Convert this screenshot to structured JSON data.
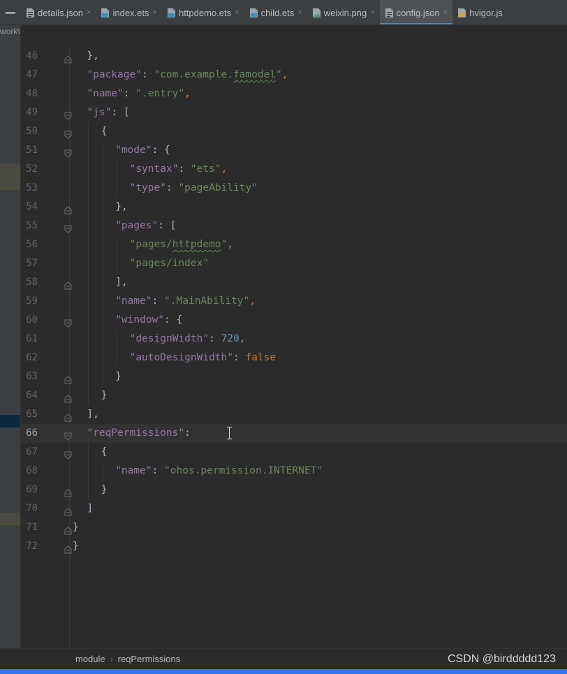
{
  "tabs": [
    {
      "label": "details.json",
      "icon": "json-file-icon",
      "active": false,
      "closable": true
    },
    {
      "label": "index.ets",
      "icon": "ets-file-icon",
      "active": false,
      "closable": true
    },
    {
      "label": "httpdemo.ets",
      "icon": "ets-file-icon",
      "active": false,
      "closable": true
    },
    {
      "label": "child.ets",
      "icon": "ets-file-icon",
      "active": false,
      "closable": true
    },
    {
      "label": "weixin.png",
      "icon": "image-file-icon",
      "active": false,
      "closable": true
    },
    {
      "label": "config.json",
      "icon": "json-file-icon",
      "active": true,
      "closable": true
    },
    {
      "label": "hvigor.js",
      "icon": "js-file-icon",
      "active": false,
      "closable": true
    }
  ],
  "tab_close_glyph": "×",
  "project_path_fragment": "work\\",
  "editor": {
    "current_line": 66,
    "lines": [
      {
        "n": "46",
        "fold": "end"
      },
      {
        "n": "47",
        "fold": ""
      },
      {
        "n": "48",
        "fold": ""
      },
      {
        "n": "49",
        "fold": "start"
      },
      {
        "n": "50",
        "fold": "start"
      },
      {
        "n": "51",
        "fold": "start"
      },
      {
        "n": "52",
        "fold": ""
      },
      {
        "n": "53",
        "fold": ""
      },
      {
        "n": "54",
        "fold": "end"
      },
      {
        "n": "55",
        "fold": "start"
      },
      {
        "n": "56",
        "fold": ""
      },
      {
        "n": "57",
        "fold": ""
      },
      {
        "n": "58",
        "fold": "end"
      },
      {
        "n": "59",
        "fold": ""
      },
      {
        "n": "60",
        "fold": "start"
      },
      {
        "n": "61",
        "fold": ""
      },
      {
        "n": "62",
        "fold": ""
      },
      {
        "n": "63",
        "fold": "end"
      },
      {
        "n": "64",
        "fold": "end"
      },
      {
        "n": "65",
        "fold": "end"
      },
      {
        "n": "66",
        "fold": "start"
      },
      {
        "n": "67",
        "fold": "start"
      },
      {
        "n": "68",
        "fold": ""
      },
      {
        "n": "69",
        "fold": "end"
      },
      {
        "n": "70",
        "fold": "end"
      },
      {
        "n": "71",
        "fold": "end"
      },
      {
        "n": "72",
        "fold": "end"
      }
    ],
    "tokens": {
      "l46": "},",
      "l47_key": "\"package\"",
      "l47_val": "\"com.example.",
      "l47_val_typo": "famodel",
      "l47_val_end": "\"",
      "l48_key": "\"name\"",
      "l48_val": "\".entry\"",
      "l49_key": "\"js\"",
      "l49_open": "[",
      "l50": "{",
      "l51_key": "\"mode\"",
      "l51_open": "{",
      "l52_key": "\"syntax\"",
      "l52_val": "\"ets\"",
      "l53_key": "\"type\"",
      "l53_val": "\"pageAbility\"",
      "l54": "},",
      "l55_key": "\"pages\"",
      "l55_open": "[",
      "l56_val_start": "\"pages/",
      "l56_val_typo": "httpdemo",
      "l56_val_end": "\"",
      "l57_val": "\"pages/index\"",
      "l58": "],",
      "l59_key": "\"name\"",
      "l59_val": "\".MainAbility\"",
      "l60_key": "\"window\"",
      "l60_open": "{",
      "l61_key": "\"designWidth\"",
      "l61_val": "720",
      "l62_key": "\"autoDesignWidth\"",
      "l62_val": "false",
      "l63": "}",
      "l64": "}",
      "l65": "],",
      "l66_key": "\"reqPermissions\"",
      "l67": "{",
      "l68_key": "\"name\"",
      "l68_val": "\"ohos.permission.INTERNET\"",
      "l69": "}",
      "l70": "]",
      "l71": "}",
      "l72": "}",
      "colon": ": ",
      "comma": ","
    }
  },
  "breadcrumb": [
    "module",
    "reqPermissions"
  ],
  "breadcrumb_separator": "›",
  "watermark": "CSDN @birddddd123",
  "colors": {
    "editor_bg": "#2b2b2b",
    "json_key": "#9876aa",
    "json_string": "#6a8759",
    "json_number": "#6897bb",
    "json_keyword": "#cc7832",
    "accent_tab": "#4a88c7",
    "status_bar": "#3574f0"
  }
}
